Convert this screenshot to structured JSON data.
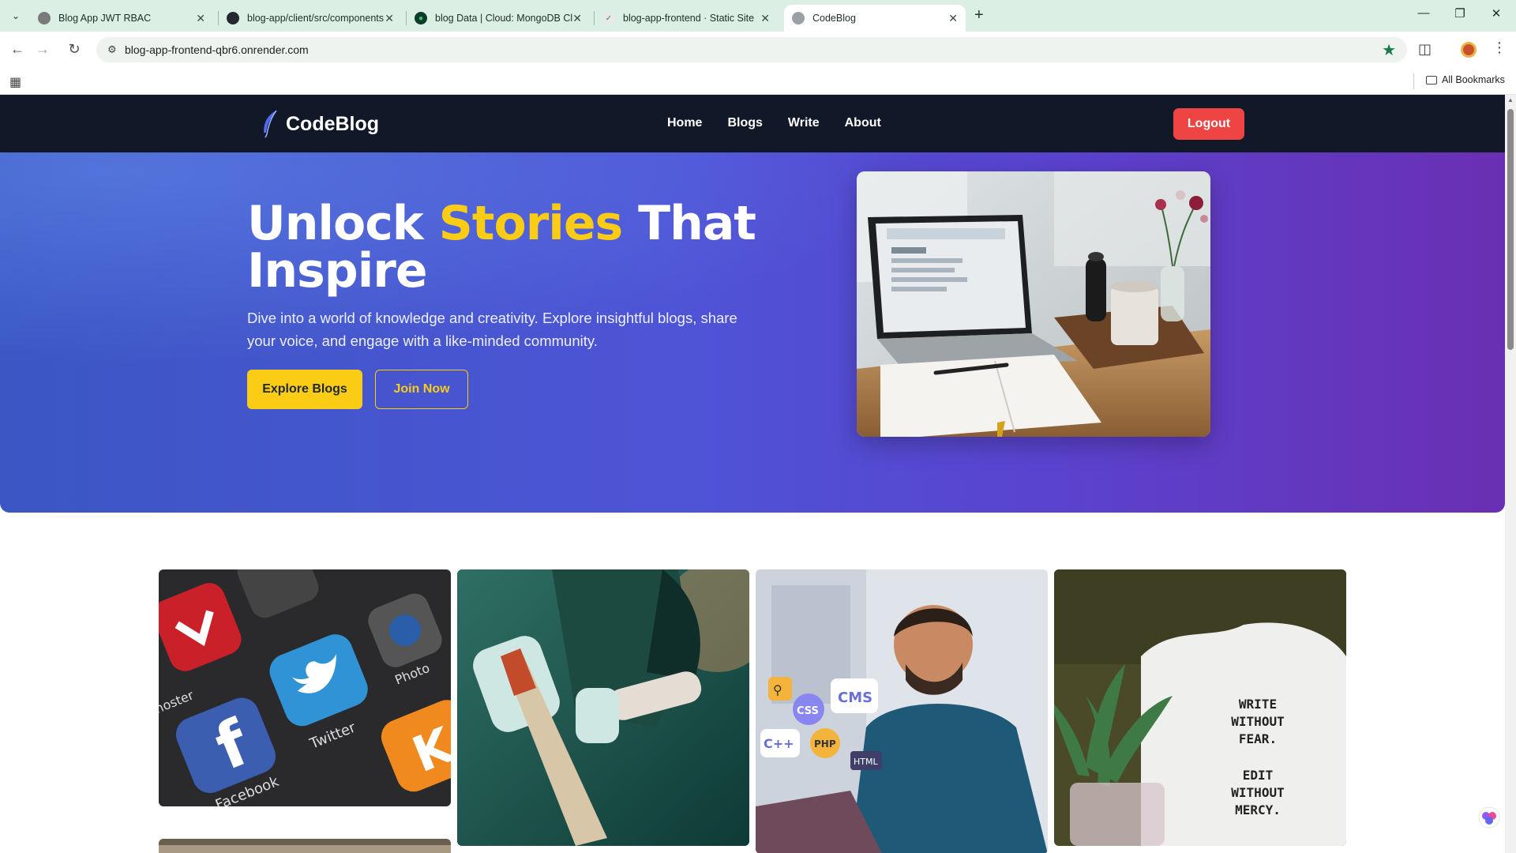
{
  "browser": {
    "tabs": [
      {
        "title": "Blog App JWT RBAC"
      },
      {
        "title": "blog-app/client/src/components"
      },
      {
        "title": "blog Data | Cloud: MongoDB Cl"
      },
      {
        "title": "blog-app-frontend · Static Site"
      },
      {
        "title": "CodeBlog"
      }
    ],
    "url": "blog-app-frontend-qbr6.onrender.com",
    "all_bookmarks": "All Bookmarks"
  },
  "site": {
    "brand": "CodeBlog",
    "nav": {
      "home": "Home",
      "blogs": "Blogs",
      "write": "Write",
      "about": "About",
      "logout": "Logout"
    },
    "hero": {
      "title_part1": "Unlock ",
      "title_accent": "Stories",
      "title_part2": " That Inspire",
      "subtitle": "Dive into a world of knowledge and creativity. Explore insightful blogs, share your voice, and engage with a like-minded community.",
      "explore_label": "Explore Blogs",
      "join_label": "Join Now"
    },
    "gallery": {
      "apps_card": {
        "apps": [
          "Twitter",
          "Facebook",
          "Phoster",
          "Photo"
        ]
      },
      "code_card": {
        "bubbles": [
          "CMS",
          "CSS",
          "C++",
          "PHP",
          "HTML"
        ]
      },
      "mug_card": {
        "lines": [
          "WRITE",
          "WITHOUT",
          "FEAR.",
          "EDIT",
          "WITHOUT",
          "MERCY."
        ]
      }
    }
  },
  "colors": {
    "nav_bg": "#111827",
    "accent_yellow": "#facc15",
    "logout_red": "#ef4444",
    "hero_start": "#3b57c4",
    "hero_end": "#6a2fb3"
  }
}
